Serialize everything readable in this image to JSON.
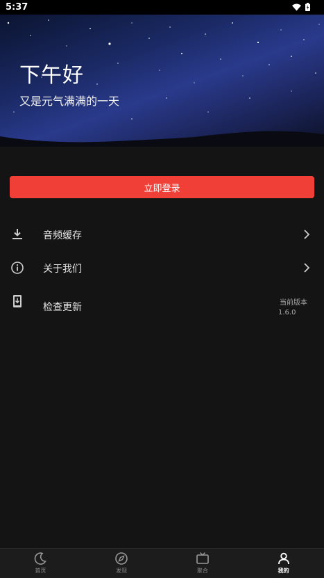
{
  "status_bar": {
    "time": "5:37"
  },
  "banner": {
    "greeting": "下午好",
    "subtitle": "又是元气满满的一天"
  },
  "login_button": {
    "label": "立即登录"
  },
  "menu": {
    "items": [
      {
        "label": "音频缓存",
        "icon": "download-icon"
      },
      {
        "label": "关于我们",
        "icon": "info-icon"
      },
      {
        "label": "检查更新",
        "icon": "phone-update-icon",
        "version_label": "当前版本",
        "version_value": "1.6.0"
      }
    ]
  },
  "tabs": [
    {
      "label": "首页",
      "icon": "moon-icon"
    },
    {
      "label": "发现",
      "icon": "compass-icon"
    },
    {
      "label": "聚合",
      "icon": "tv-icon"
    },
    {
      "label": "我的",
      "icon": "person-icon",
      "active": true
    }
  ],
  "colors": {
    "accent": "#f03f36",
    "background": "#141414",
    "tab_bar": "#1c1c1c"
  }
}
